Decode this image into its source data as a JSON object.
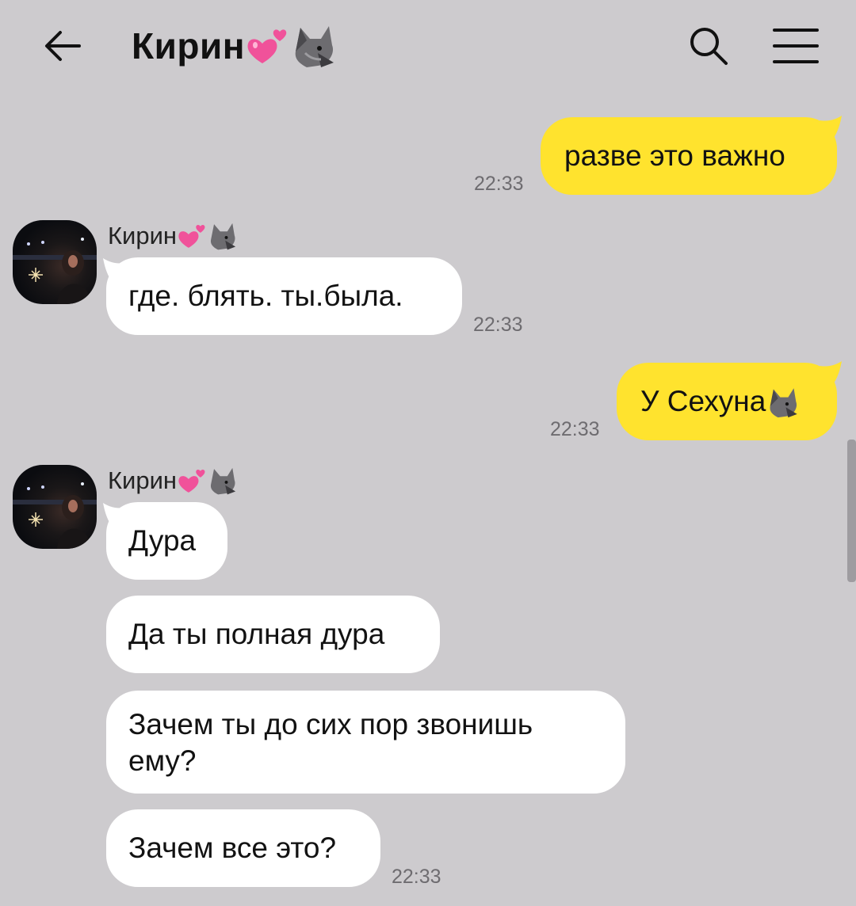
{
  "header": {
    "title": "Кирин",
    "back_icon": "arrow-left-icon",
    "search_icon": "search-icon",
    "menu_icon": "hamburger-menu-icon"
  },
  "colors": {
    "background": "#cdcbce",
    "outgoing_bubble": "#ffe32e",
    "incoming_bubble": "#ffffff",
    "timestamp": "#6e6c70"
  },
  "messages": [
    {
      "direction": "out",
      "text": "разве это важно",
      "time": "22:33"
    },
    {
      "direction": "in",
      "sender": "Кирин",
      "text": "где. блять. ты.была.",
      "time": "22:33"
    },
    {
      "direction": "out",
      "text": "У Сехуна",
      "time": "22:33"
    },
    {
      "direction": "in",
      "sender": "Кирин",
      "text": "Дура"
    },
    {
      "direction": "in",
      "text": "Да ты полная дура"
    },
    {
      "direction": "in",
      "text": "Зачем ты до сих пор звонишь ему?"
    },
    {
      "direction": "in",
      "text": "Зачем все это?",
      "time": "22:33"
    }
  ]
}
